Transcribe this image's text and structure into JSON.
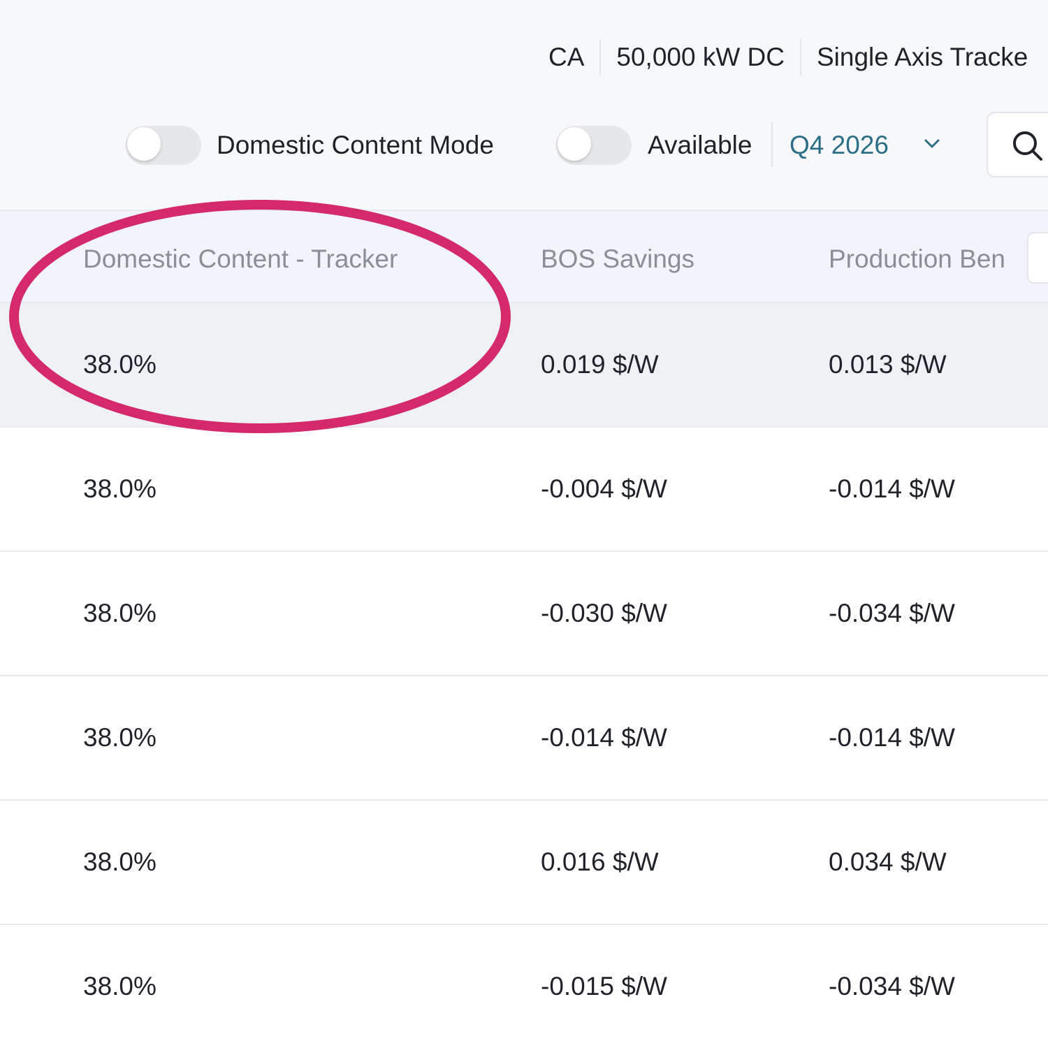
{
  "header": {
    "info": [
      "CA",
      "50,000 kW DC",
      "Single Axis Tracke"
    ]
  },
  "toolbar": {
    "domestic_toggle_label": "Domestic Content Mode",
    "domestic_toggle_on": false,
    "available_toggle_label": "Available",
    "available_toggle_on": false,
    "quarter": "Q4 2026",
    "icons": [
      "chevron-down-icon",
      "search-icon"
    ]
  },
  "table": {
    "columns": [
      "Domestic Content - Tracker",
      "BOS Savings",
      "Production Ben"
    ],
    "rows": [
      [
        "38.0%",
        "0.019 $/W",
        "0.013 $/W"
      ],
      [
        "38.0%",
        "-0.004 $/W",
        "-0.014 $/W"
      ],
      [
        "38.0%",
        "-0.030 $/W",
        "-0.034 $/W"
      ],
      [
        "38.0%",
        "-0.014 $/W",
        "-0.014 $/W"
      ],
      [
        "38.0%",
        "0.016 $/W",
        "0.034 $/W"
      ],
      [
        "38.0%",
        "-0.015 $/W",
        "-0.034 $/W"
      ]
    ]
  },
  "colors": {
    "accent_link": "#2c6e86",
    "annotation_circle": "#d42a6a",
    "header_bg": "#f1f4fa",
    "highlight_row": "#f0f1f5"
  }
}
